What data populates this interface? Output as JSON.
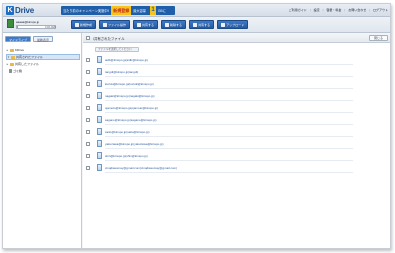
{
  "header": {
    "logo_mark": "K",
    "logo_text": "Drive",
    "promo": {
      "text": "当たり前のキャンペーン実施中!!",
      "badge": "新規登録",
      "offer": "最大容量",
      "num": "1",
      "unit": "GBに"
    },
    "links": [
      "ご利用ガイド",
      "設定",
      "容量・料金",
      "お問い合わせ",
      "ログアウト"
    ]
  },
  "account": {
    "name": "aaaaa@kinspo.jp",
    "quota_text": "0.0/1.0GB",
    "quota_fraction": 0.03
  },
  "toolbar": {
    "buttons": [
      {
        "label": "新規作成"
      },
      {
        "label": "ファイル操作"
      },
      {
        "label": "共有する"
      },
      {
        "label": "削除する"
      },
      {
        "label": "共有する"
      },
      {
        "label": "アップロード"
      }
    ]
  },
  "sidebar": {
    "tabs": [
      {
        "label": "マイドライブ"
      },
      {
        "label": "最新表示"
      }
    ],
    "tree": [
      {
        "label": "KDrive",
        "arrow": "▸"
      },
      {
        "label": "共有されたファイル",
        "arrow": "▾"
      },
      {
        "label": "共有したファイル",
        "arrow": "▸"
      },
      {
        "label": "ゴミ箱",
        "arrow": ""
      }
    ]
  },
  "main": {
    "title": "/共有されたファイル",
    "close_label": "閉じる",
    "upload_hint": "ファイルを選択してください",
    "files": [
      {
        "label": "aidb@kinspo.jp(aidb@kinspo.jp)"
      },
      {
        "label": "tangdi@kinspo.jp(tangdi)"
      },
      {
        "label": "kuzuki@kinspo.jp(kuzuki@kinspo.jp)"
      },
      {
        "label": "nagaki@kinspo.jp(nagaki@kinspo.jp)"
      },
      {
        "label": "ojamoto@kinspo.jp(ojamoto@kinspo.jp)"
      },
      {
        "label": "sagano@kinspo.jp(sagano@kinspo.jp)"
      },
      {
        "label": "saito@kinspo.jp(saito@kinspo.jp)"
      },
      {
        "label": "yakuzawa@kinspo.jp(yakuzawa@kinspo.jp)"
      },
      {
        "label": "shin@kinspo.jp(shin@kinspo.jp)"
      },
      {
        "label": "cinqdiasomay@gmail.com(cinqdiasomay@gmail.com)"
      }
    ]
  },
  "colors": {
    "accent": "#245aa3",
    "promo": "#1f5ea8",
    "badge": "#f6c51c",
    "link": "#2c5aa0"
  }
}
